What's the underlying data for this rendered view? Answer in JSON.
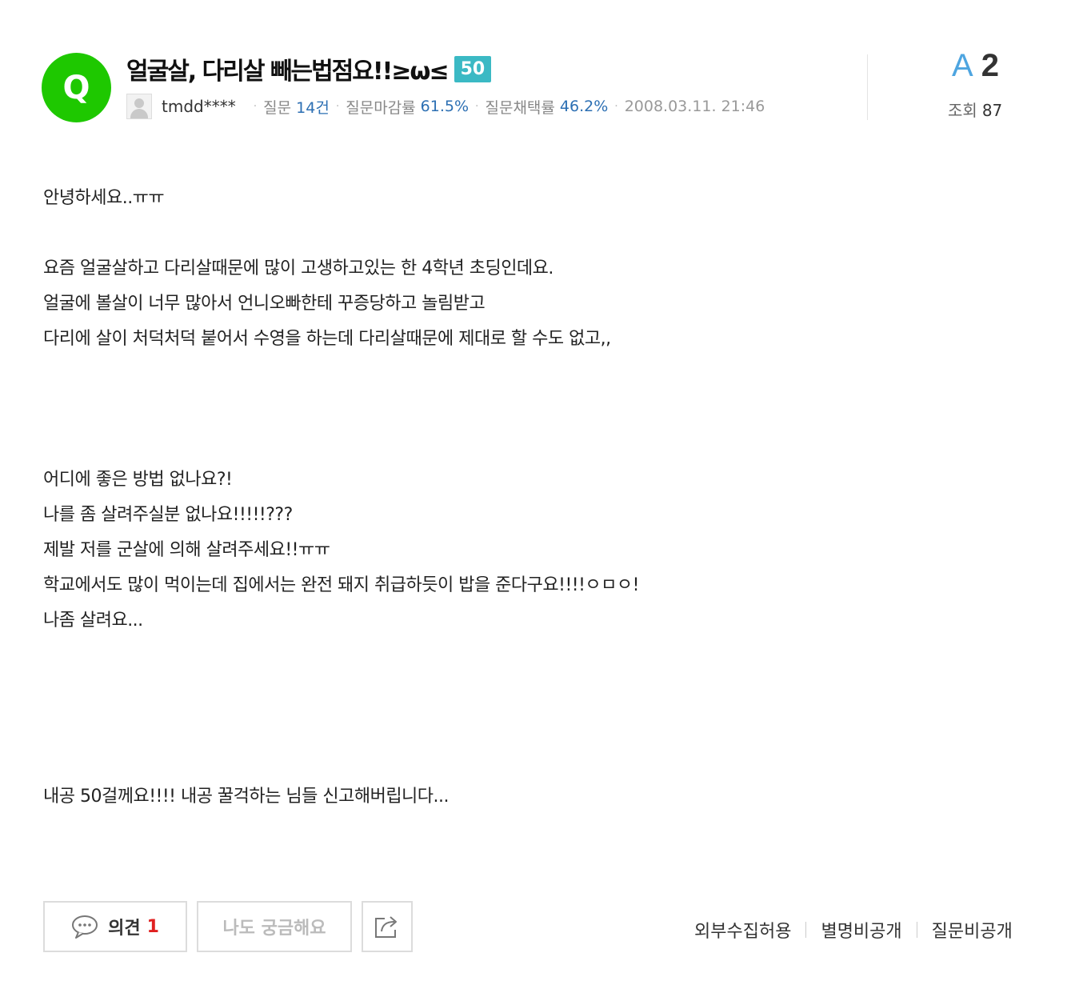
{
  "question": {
    "badge_letter": "Q",
    "title": "얼굴살, 다리살 빼는법점요!!≥ω≤",
    "points": "50",
    "user": "tmdd****",
    "stats": {
      "questions_label": "질문",
      "questions_value": "14건",
      "close_rate_label": "질문마감률",
      "close_rate_value": "61.5%",
      "adopt_rate_label": "질문채택률",
      "adopt_rate_value": "46.2%",
      "date": "2008.03.11. 21:46"
    }
  },
  "summary": {
    "answer_letter": "A",
    "answer_count": "2",
    "views_label": "조회",
    "views_value": "87"
  },
  "content": {
    "lines": [
      "안녕하세요..ㅠㅠ",
      "",
      "요즘 얼굴살하고 다리살때문에 많이 고생하고있는 한 4학년 초딩인데요.",
      "얼굴에 볼살이 너무 많아서 언니오빠한테 꾸증당하고 놀림받고",
      "다리에 살이 처덕처덕 붙어서 수영을 하는데 다리살때문에 제대로 할 수도 없고,,",
      "",
      "",
      "",
      "어디에 좋은 방법 없나요?!",
      "나를 좀 살려주실분 없나요!!!!!???",
      "제발 저를 군살에 의해 살려주세요!!ㅠㅠ",
      "학교에서도 많이 먹이는데 집에서는 완전 돼지 취급하듯이 밥을 준다구요!!!!ㅇㅁㅇ!",
      "나좀 살려요...",
      "",
      "",
      "",
      "",
      "내공 50걸께요!!!! 내공 꿀걱하는 님들 신고해버립니다..."
    ]
  },
  "actions": {
    "opinion_label": "의견",
    "opinion_count": "1",
    "curious_label": "나도 궁금해요"
  },
  "settings": {
    "external": "외부수집허용",
    "alias_private": "별명비공개",
    "question_private": "질문비공개"
  },
  "colors": {
    "q_badge": "#1ec800",
    "points_badge": "#3bb9c4",
    "stat_value": "#2c6fb3",
    "answer_letter": "#4ea5e0",
    "opinion_count": "#e02020"
  }
}
